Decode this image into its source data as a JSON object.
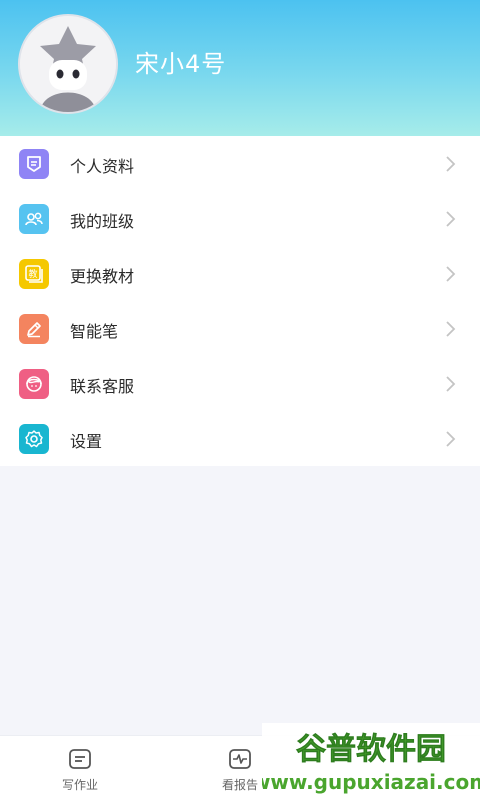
{
  "profile": {
    "name": "宋小4号"
  },
  "menu": {
    "items": [
      {
        "label": "个人资料",
        "icon": "profile-card-icon",
        "color": "#8f84f5"
      },
      {
        "label": "我的班级",
        "icon": "class-people-icon",
        "color": "#56c3f0"
      },
      {
        "label": "更换教材",
        "icon": "textbook-icon",
        "color": "#f5c800",
        "glyph": "教"
      },
      {
        "label": "智能笔",
        "icon": "pen-icon",
        "color": "#f4845f"
      },
      {
        "label": "联系客服",
        "icon": "customer-service-icon",
        "color": "#ef5f84"
      },
      {
        "label": "设置",
        "icon": "gear-icon",
        "color": "#19b6d0"
      }
    ]
  },
  "tabbar": {
    "tabs": [
      {
        "label": "写作业",
        "icon": "homework-icon"
      },
      {
        "label": "看报告",
        "icon": "report-icon"
      }
    ]
  },
  "watermark": {
    "title": "谷普软件园",
    "url": "www.gupuxiazai.com"
  }
}
